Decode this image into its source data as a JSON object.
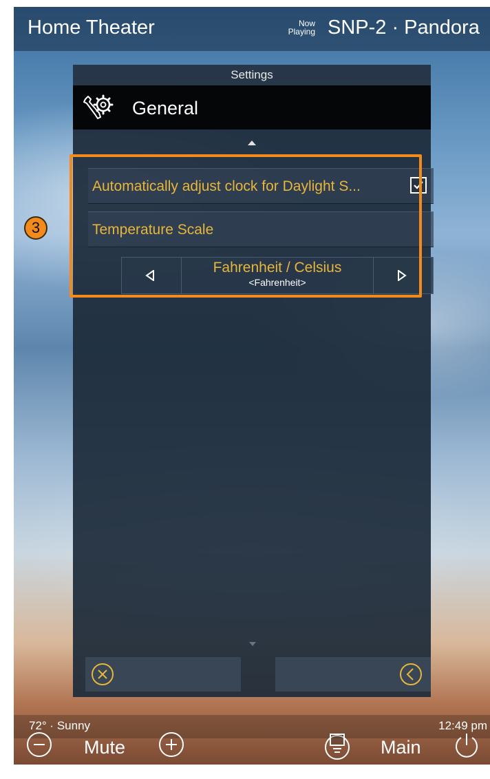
{
  "topbar": {
    "title": "Home Theater",
    "now_playing_top": "Now",
    "now_playing_bottom": "Playing",
    "source": "SNP-2 · Pandora"
  },
  "dialog": {
    "header": "Settings",
    "section_title": "General",
    "section_icon": "wrench-gear-icon",
    "settings": [
      {
        "label": "Automatically adjust clock for Daylight S...",
        "checked": true
      },
      {
        "label": "Temperature Scale"
      }
    ],
    "selector": {
      "title": "Fahrenheit / Celsius",
      "value": "<Fahrenheit>"
    },
    "annotation_badge": "3"
  },
  "status": {
    "weather": "72° · Sunny",
    "time": "12:49 pm"
  },
  "bottom_bar": {
    "mute_label": "Mute",
    "main_label": "Main"
  },
  "colors": {
    "accent_text": "#e7b63a",
    "highlight": "#f28a1c"
  }
}
